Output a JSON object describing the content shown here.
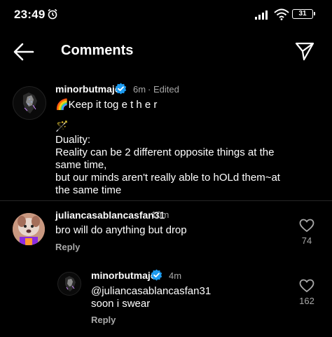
{
  "status": {
    "time": "23:49",
    "battery": "31"
  },
  "header": {
    "title": "Comments"
  },
  "comments": [
    {
      "username": "minorbutmajor",
      "time": "6m",
      "edited": "· Edited",
      "line1": "🌈Keep it tog e t  h  e  r",
      "line2": "🪄",
      "line3": "Duality:\nReality can be 2 different opposite things at the\nsame time,\nbut our minds aren't really able to hOLd them~at\nthe same time"
    },
    {
      "username": "juliancasablancasfan31",
      "time": "10m",
      "text": "bro will do anything but drop",
      "reply": "Reply",
      "likes": "74"
    },
    {
      "username": "minorbutmajor",
      "time": "4m",
      "text": "@juliancasablancasfan31\nsoon i swear",
      "reply": "Reply",
      "likes": "162"
    }
  ]
}
